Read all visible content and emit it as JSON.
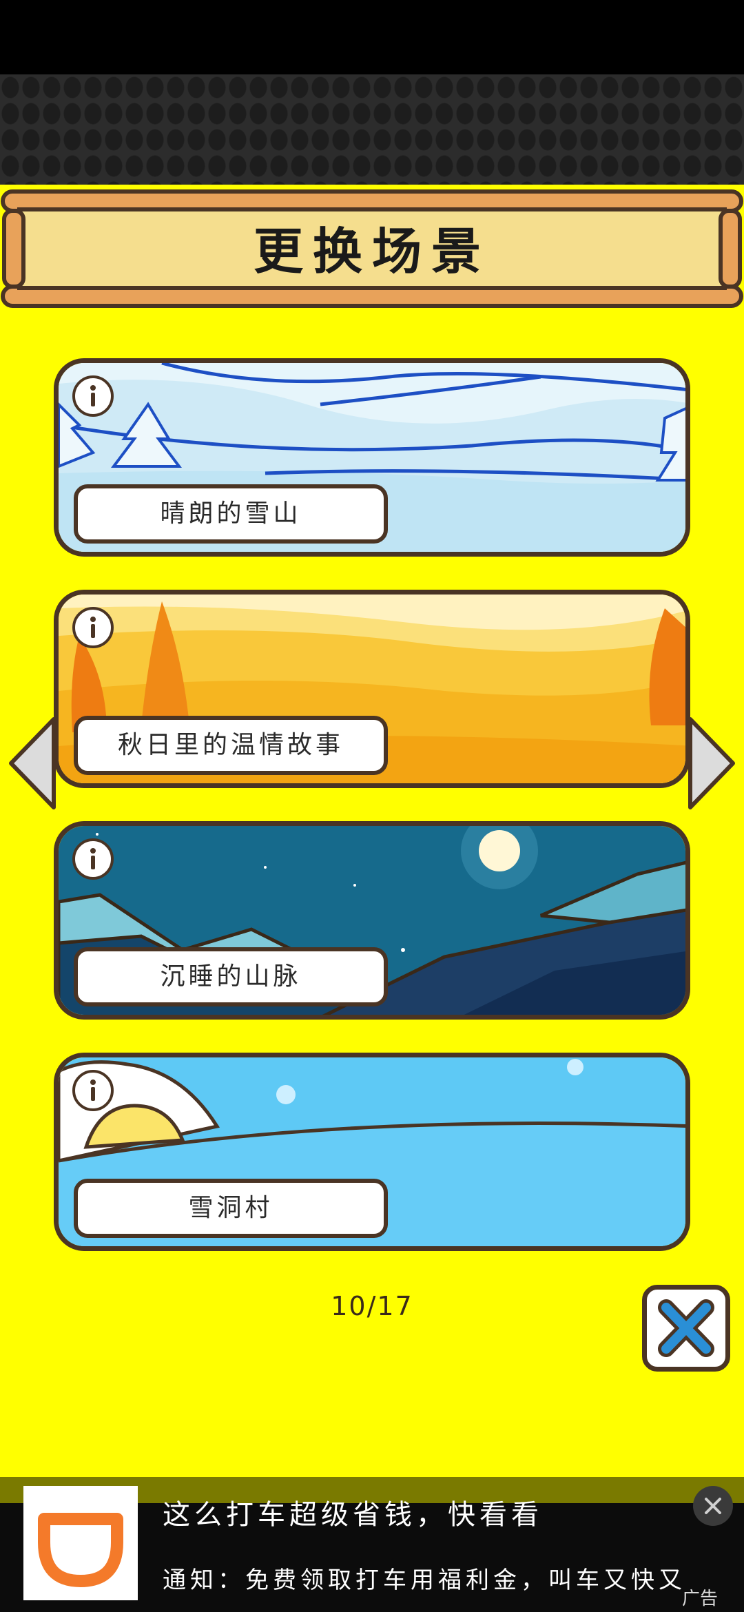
{
  "header": {
    "title": "更换场景"
  },
  "scenes": [
    {
      "name": "晴朗的雪山",
      "theme": "snow-mountain"
    },
    {
      "name": "秋日里的温情故事",
      "theme": "autumn"
    },
    {
      "name": "沉睡的山脉",
      "theme": "night-mountains"
    },
    {
      "name": "雪洞村",
      "theme": "snow-village"
    }
  ],
  "pagination": {
    "current": 10,
    "total": 17,
    "label": "10/17"
  },
  "colors": {
    "background": "#ffff00",
    "border": "#4a3424",
    "banner": "#f5de8e",
    "close_x": "#2a8fd6"
  },
  "ad": {
    "headline": "这么打车超级省钱，快看看",
    "subtext": "通知：免费领取打车用福利金，叫车又快又",
    "tag": "广告",
    "logo_icon": "didi-logo-icon"
  }
}
